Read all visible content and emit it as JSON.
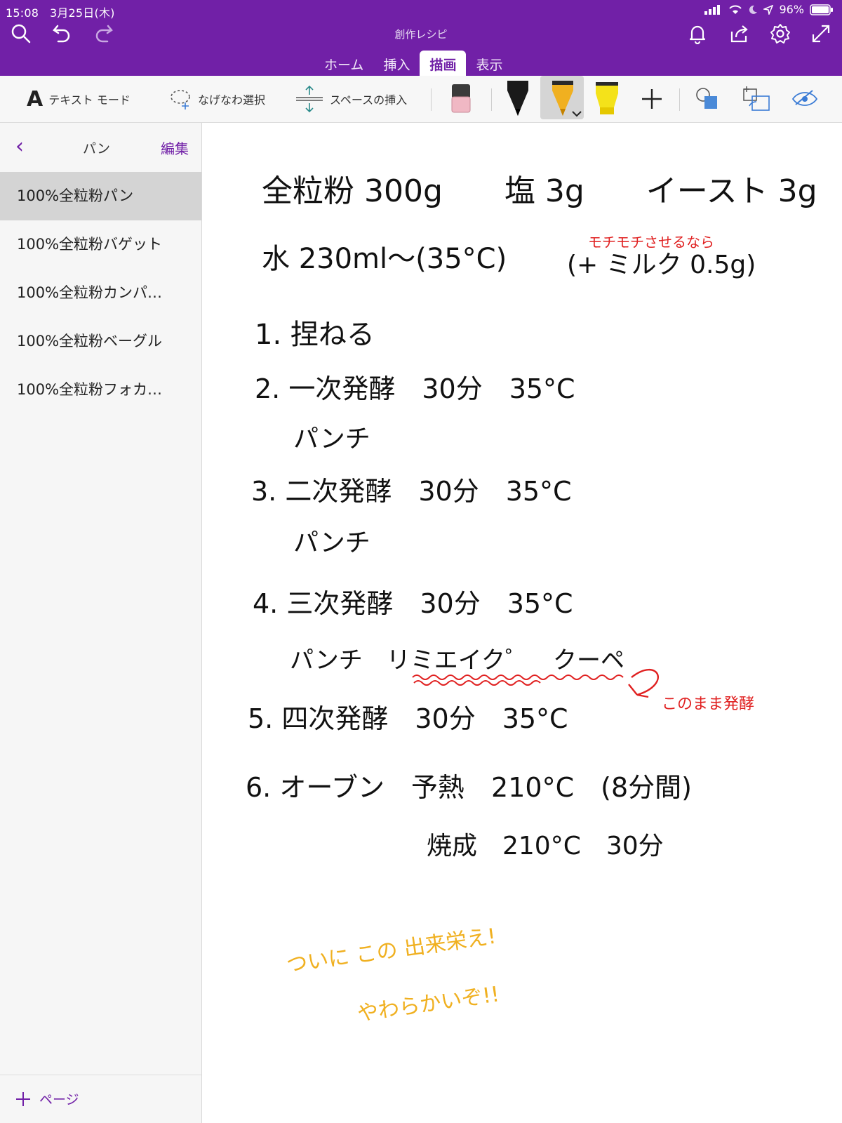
{
  "status": {
    "time": "15:08",
    "date": "3月25日(木)",
    "battery": "96%"
  },
  "app": {
    "notebook_title": "創作レシピ"
  },
  "tabs": [
    {
      "label": "ホーム"
    },
    {
      "label": "挿入"
    },
    {
      "label": "描画",
      "active": true
    },
    {
      "label": "表示"
    }
  ],
  "toolbar": {
    "text_mode": "テキスト モード",
    "lasso": "なげなわ選択",
    "insert_space": "スペースの挿入"
  },
  "sidebar": {
    "section_title": "パン",
    "edit_label": "編集",
    "pages": [
      {
        "title": "100%全粒粉パン",
        "active": true
      },
      {
        "title": "100%全粒粉バゲット"
      },
      {
        "title": "100%全粒粉カンパ…"
      },
      {
        "title": "100%全粒粉ベーグル"
      },
      {
        "title": "100%全粒粉フォカ…"
      }
    ],
    "add_page": "ページ"
  },
  "note": {
    "ingredients1": "全粒粉 300g　　塩 3g　　イースト 3g",
    "ingredients2": "水 230ml〜(35°C)",
    "milk_paren": "(+ ミルク 0.5g)",
    "milk_note": "モチモチさせるなら",
    "steps": [
      "1. 捏ねる",
      "2. 一次発酵　30分　35°C",
      "パンチ",
      "3. 二次発酵　30分　35°C",
      "パンチ",
      "4. 三次発酵　30分　35°C",
      "パンチ　リミエイク゜　クーペ",
      "5. 四次発酵　30分　35°C",
      "6. オーブン　予熱　210°C　(8分間)",
      "焼成　210°C　30分"
    ],
    "side_note": "このまま発酵",
    "comment1": "ついに この 出来栄え!",
    "comment2": "やわらかいぞ!!",
    "colors": {
      "ink": "#111111",
      "red": "#e02020",
      "orange": "#f0b020"
    }
  }
}
